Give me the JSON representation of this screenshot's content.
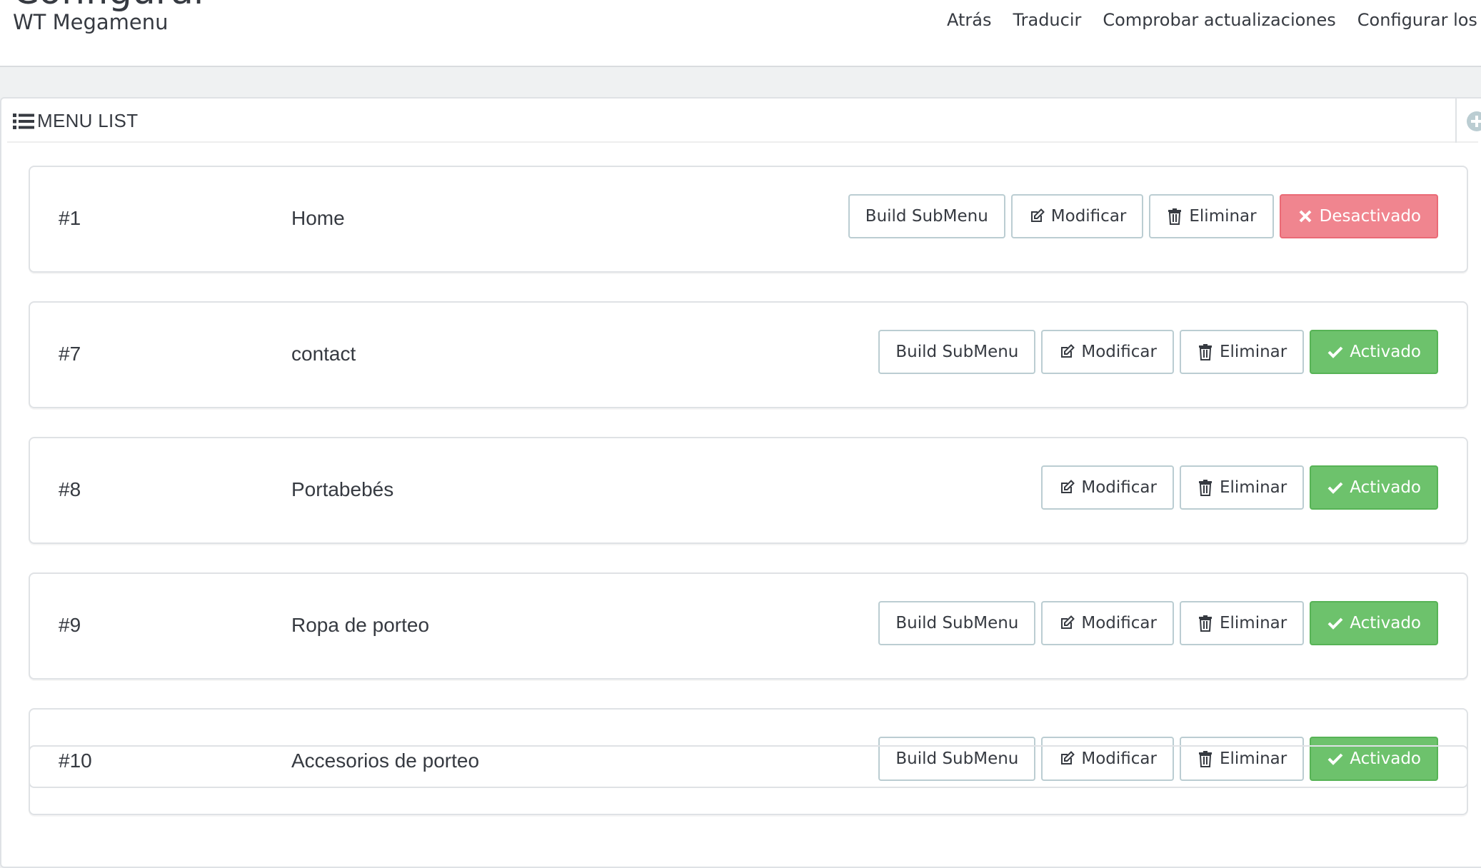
{
  "header": {
    "title": "Configurar",
    "module_name": "WT Megamenu",
    "toolbar": [
      {
        "label": "Atrás"
      },
      {
        "label": "Traducir"
      },
      {
        "label": "Comprobar actualizaciones"
      },
      {
        "label": "Configurar los hoo"
      }
    ]
  },
  "panel": {
    "title": "MENU LIST",
    "title_icon": "list-icon",
    "add_icon": "plus-circle-icon"
  },
  "labels": {
    "build_submenu": "Build SubMenu",
    "modify": "Modificar",
    "delete": "Eliminar",
    "enabled": "Activado",
    "disabled": "Desactivado"
  },
  "colors": {
    "enabled": "#6dc26c",
    "disabled": "#f0858f",
    "border": "#bbcdd2"
  },
  "menus": [
    {
      "id": "#1",
      "name": "Home",
      "has_submenu_button": true,
      "status": "disabled"
    },
    {
      "id": "#7",
      "name": "contact",
      "has_submenu_button": true,
      "status": "enabled"
    },
    {
      "id": "#8",
      "name": "Portabebés",
      "has_submenu_button": false,
      "status": "enabled"
    },
    {
      "id": "#9",
      "name": "Ropa de porteo",
      "has_submenu_button": true,
      "status": "enabled"
    },
    {
      "id": "#10",
      "name": "Accesorios de porteo",
      "has_submenu_button": true,
      "status": "enabled"
    }
  ]
}
